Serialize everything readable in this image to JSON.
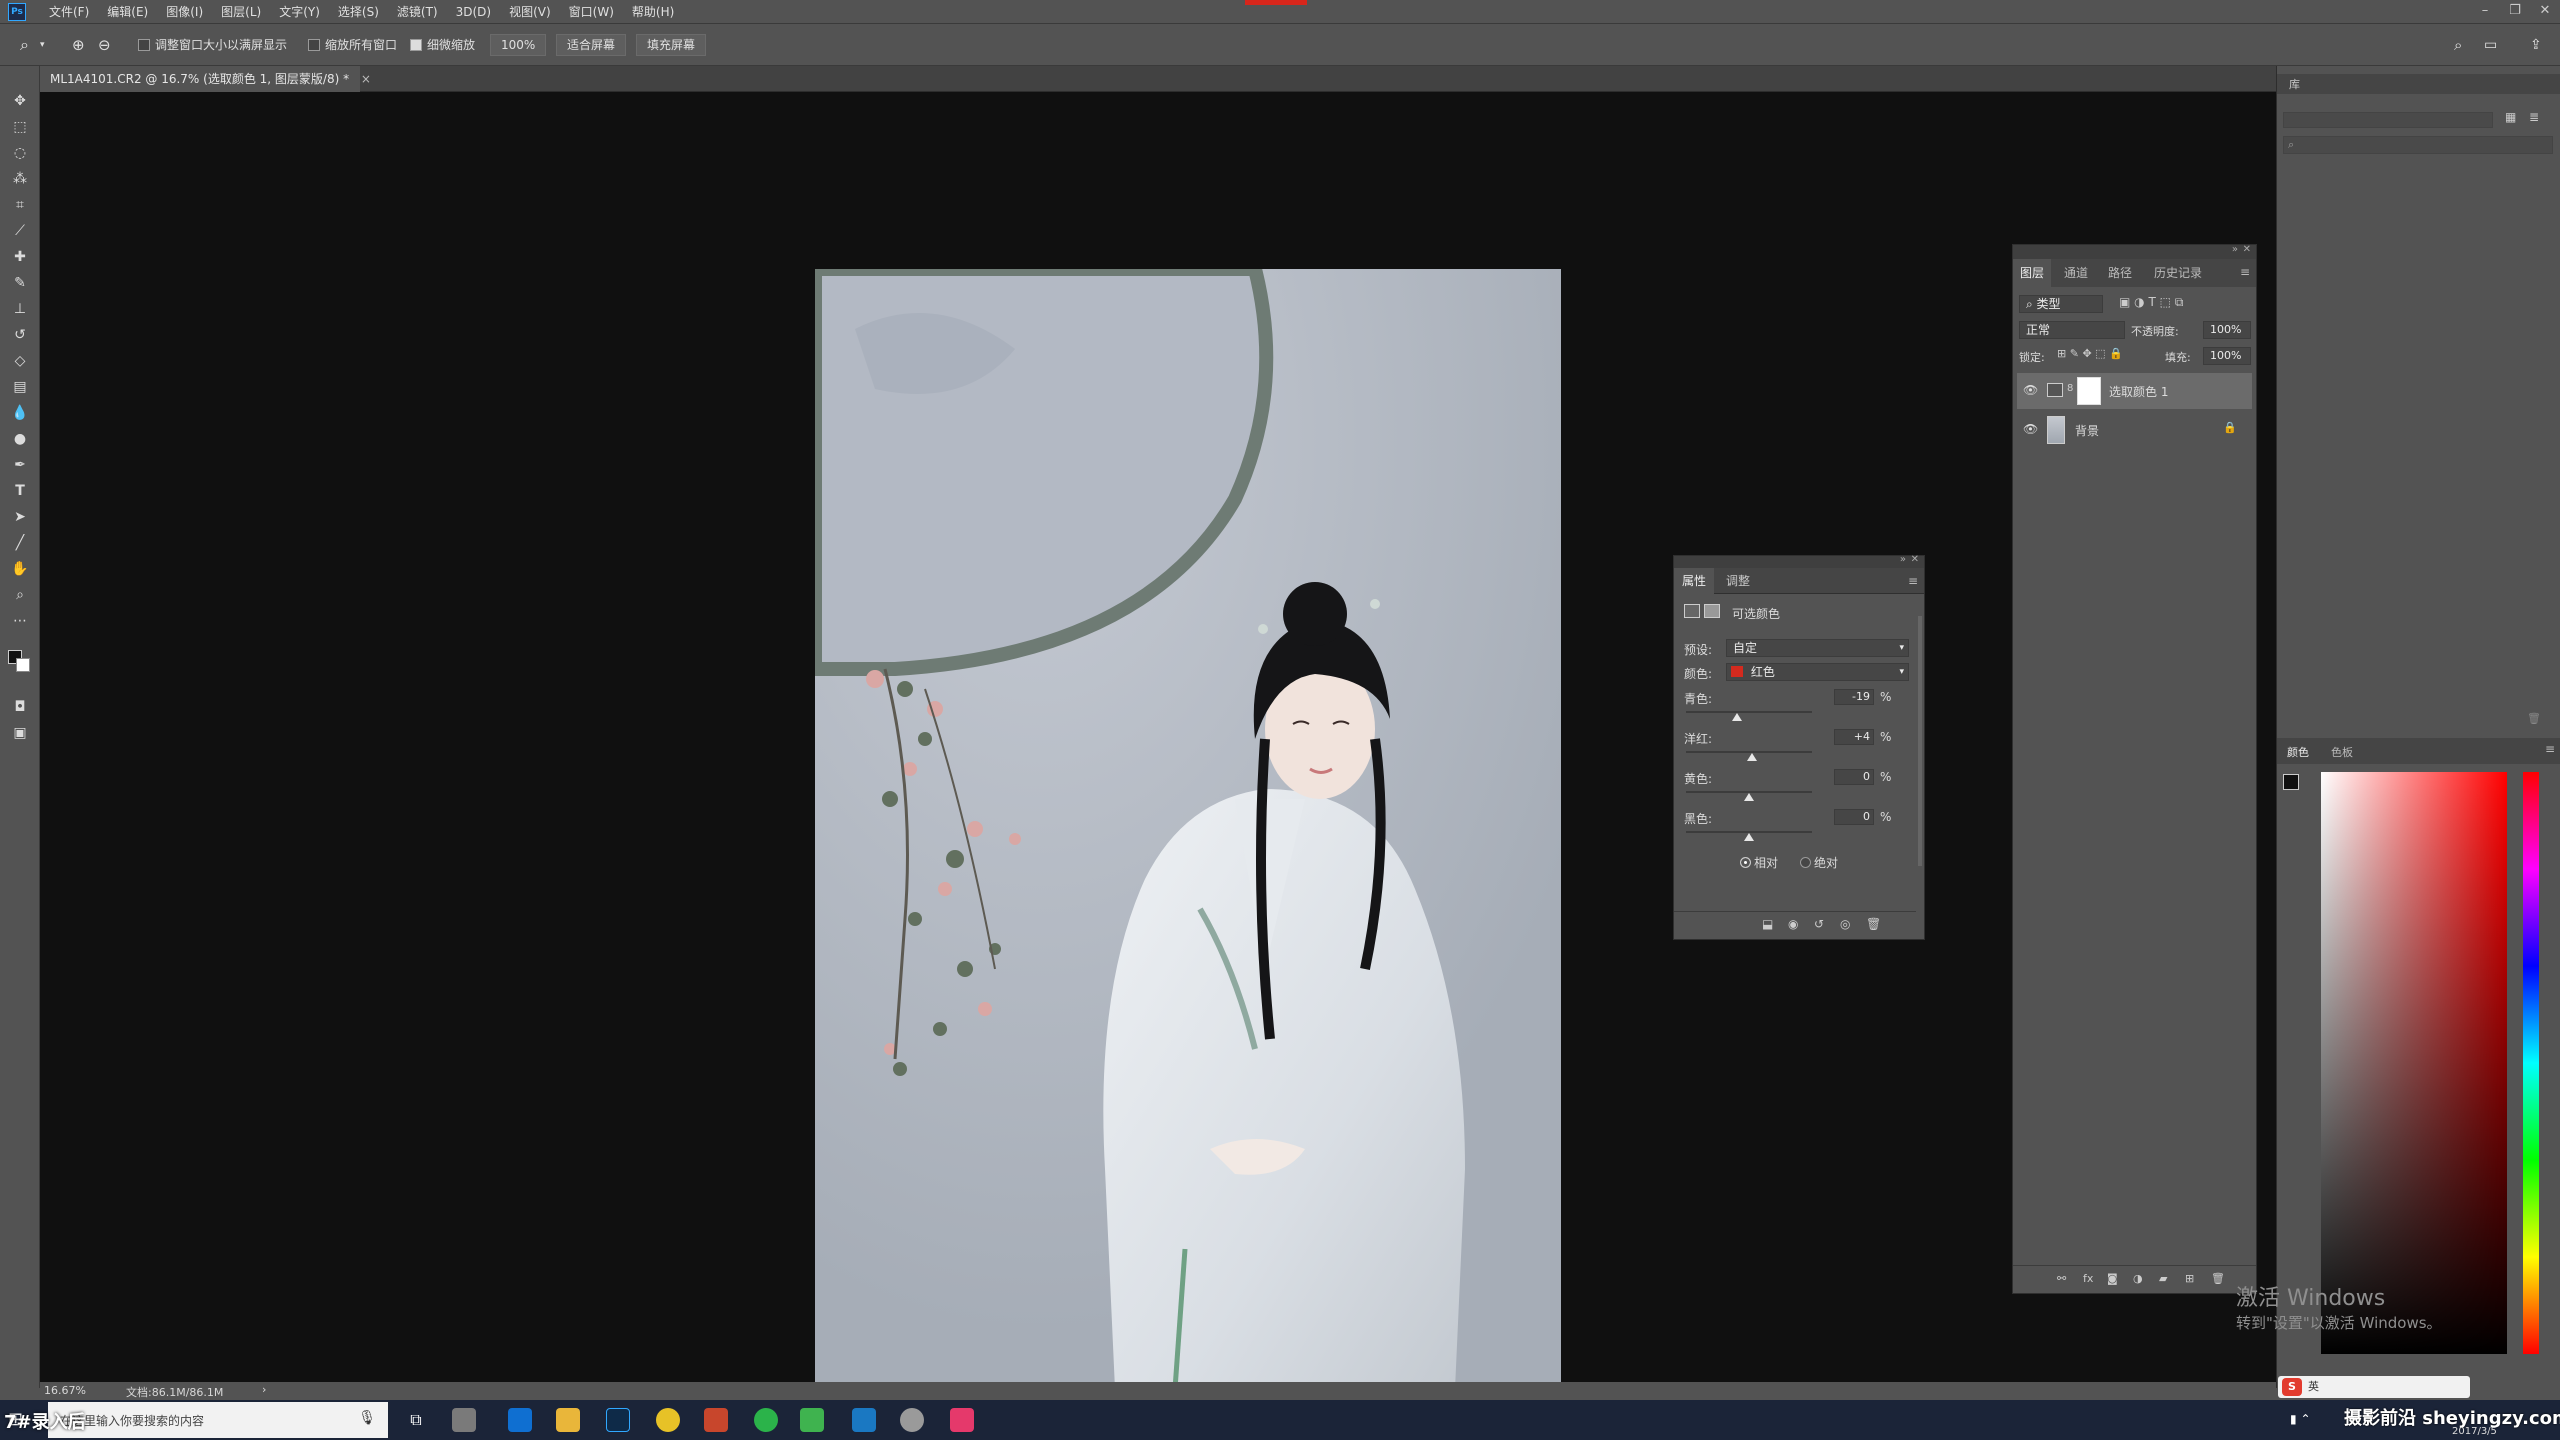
{
  "app": {
    "logo": "Ps"
  },
  "menu": [
    "文件(F)",
    "编辑(E)",
    "图像(I)",
    "图层(L)",
    "文字(Y)",
    "选择(S)",
    "滤镜(T)",
    "3D(D)",
    "视图(V)",
    "窗口(W)",
    "帮助(H)"
  ],
  "options": {
    "resize_windows": "调整窗口大小以满屏显示",
    "zoom_all": "缩放所有窗口",
    "scrubby_zoom": "细微缩放",
    "zoom_value": "100%",
    "fit_screen": "适合屏幕",
    "fill_screen": "填充屏幕"
  },
  "document": {
    "tab_title": "ML1A4101.CR2 @ 16.7% (选取颜色 1, 图层蒙版/8) *"
  },
  "status": {
    "zoom": "16.67%",
    "doc_size": "文档:86.1M/86.1M"
  },
  "properties": {
    "tabs": [
      "属性",
      "调整"
    ],
    "title": "可选颜色",
    "preset_label": "预设:",
    "preset_value": "自定",
    "colors_label": "颜色:",
    "colors_value": "红色",
    "colors_swatch": "#d42a1e",
    "sliders": [
      {
        "label": "青色:",
        "value": "-19",
        "unit": "%",
        "amount": -19
      },
      {
        "label": "洋红:",
        "value": "+4",
        "unit": "%",
        "amount": 4
      },
      {
        "label": "黄色:",
        "value": "0",
        "unit": "%",
        "amount": 0
      },
      {
        "label": "黑色:",
        "value": "0",
        "unit": "%",
        "amount": 0
      }
    ],
    "method_relative": "相对",
    "method_absolute": "绝对"
  },
  "layers": {
    "tabs": [
      "图层",
      "通道",
      "路径",
      "历史记录"
    ],
    "filter_kind": "类型",
    "blend_mode": "正常",
    "opacity_label": "不透明度:",
    "opacity_value": "100%",
    "lock_label": "锁定:",
    "fill_label": "填充:",
    "fill_value": "100%",
    "items": [
      {
        "name": "选取颜色 1"
      },
      {
        "name": "背景"
      }
    ]
  },
  "color_panel": {
    "tabs": [
      "颜色",
      "色板"
    ]
  },
  "watermark": {
    "line1": "激活 Windows",
    "line2": "转到\"设置\"以激活 Windows。"
  },
  "taskbar": {
    "search_placeholder": "在这里输入你要搜索的内容",
    "overlay_text": "7#录入后",
    "tray_site": "摄影前沿 sheyingzy.com",
    "tray_date": "2017/3/5",
    "ime_label": "英"
  }
}
